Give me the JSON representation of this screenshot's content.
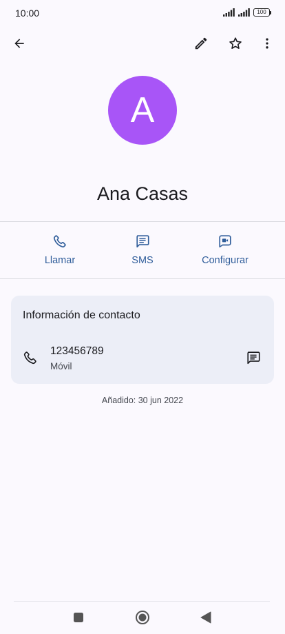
{
  "status_bar": {
    "time": "10:00",
    "battery": "100",
    "icons": [
      "signal-icon",
      "signal-icon",
      "battery-icon"
    ]
  },
  "toolbar": {
    "icons": [
      "back-arrow-icon",
      "pencil-icon",
      "star-outline-icon",
      "more-vert-icon"
    ]
  },
  "contact": {
    "avatar_letter": "A",
    "avatar_color": "#a855f7",
    "name": "Ana Casas"
  },
  "actions": [
    {
      "label": "Llamar",
      "icon": "phone-icon"
    },
    {
      "label": "SMS",
      "icon": "message-icon"
    },
    {
      "label": "Configurar",
      "icon": "video-call-icon"
    }
  ],
  "info_card": {
    "title": "Información de contacto",
    "phone": {
      "number": "123456789",
      "type": "Móvil",
      "icon": "phone-icon",
      "action_icon": "message-icon"
    }
  },
  "added_date": "Añadido: 30 jun 2022",
  "nav_bar": {
    "icons": [
      "recents-square-icon",
      "home-circle-icon",
      "back-triangle-icon"
    ]
  },
  "colors": {
    "accent": "#2f5d9a",
    "background": "#fbf9fe",
    "card": "#eceef7"
  }
}
